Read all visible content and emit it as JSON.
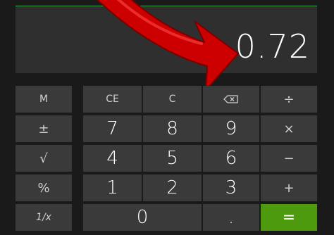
{
  "display": {
    "value": "0.72"
  },
  "memory_column": [
    {
      "name": "memory-button",
      "label": "M"
    },
    {
      "name": "plus-minus-button",
      "label": "±"
    },
    {
      "name": "square-root-button",
      "label": "√"
    },
    {
      "name": "percent-button",
      "label": "%"
    },
    {
      "name": "reciprocal-button",
      "label": "1/x"
    }
  ],
  "keys": {
    "ce": "CE",
    "c": "C",
    "divide": "÷",
    "multiply": "×",
    "minus": "−",
    "plus": "+",
    "equals": "=",
    "decimal": ".",
    "d0": "0",
    "d1": "1",
    "d2": "2",
    "d3": "3",
    "d4": "4",
    "d5": "5",
    "d6": "6",
    "d7": "7",
    "d8": "8",
    "d9": "9"
  },
  "colors": {
    "background": "#1a1a1a",
    "display": "#2f2f2f",
    "key": "#3a3a3a",
    "equals": "#4e9a0e",
    "accent_line": "#3ea04b",
    "arrow": "#cc0000"
  },
  "icons": {
    "backspace": "backspace-icon",
    "annotation": "red-curved-arrow"
  }
}
